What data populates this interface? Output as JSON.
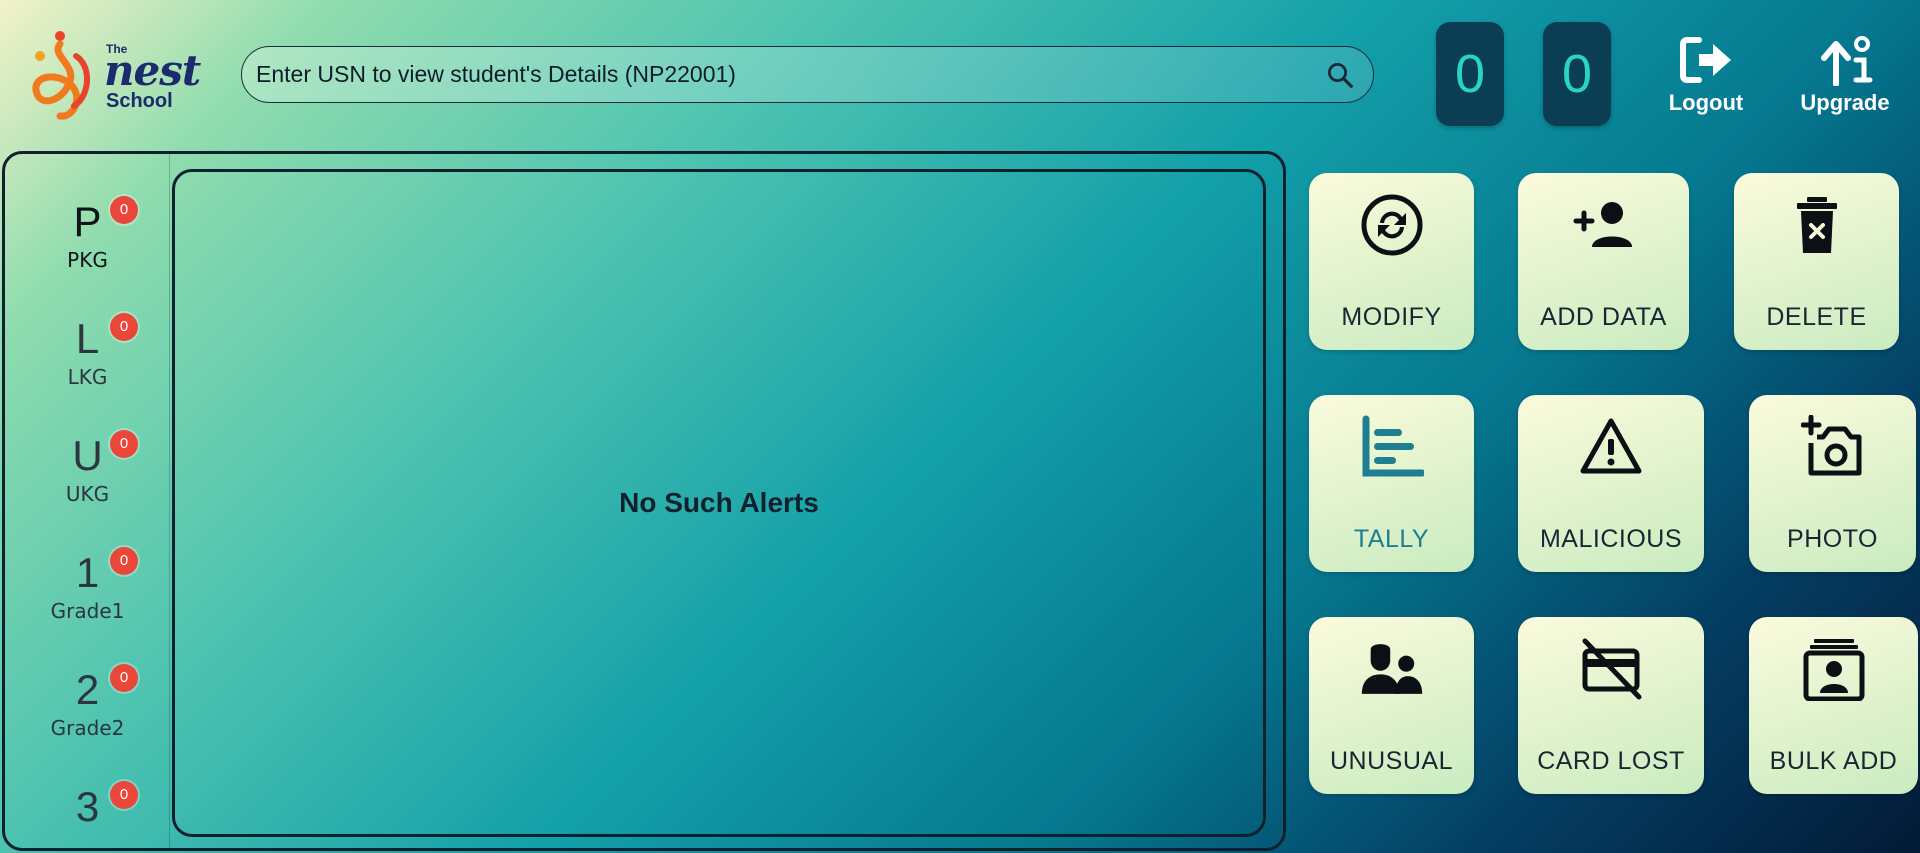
{
  "brand": {
    "line1": "The",
    "line2": "nest",
    "line3": "School"
  },
  "search": {
    "placeholder": "Enter USN to view student's Details (NP22001)"
  },
  "counters": [
    "0",
    "0"
  ],
  "header_buttons": {
    "logout": "Logout",
    "upgrade": "Upgrade"
  },
  "grades": [
    {
      "letter": "P",
      "label": "PKG",
      "badge": "0"
    },
    {
      "letter": "L",
      "label": "LKG",
      "badge": "0"
    },
    {
      "letter": "U",
      "label": "UKG",
      "badge": "0"
    },
    {
      "letter": "1",
      "label": "Grade1",
      "badge": "0"
    },
    {
      "letter": "2",
      "label": "Grade2",
      "badge": "0"
    },
    {
      "letter": "3",
      "label": "",
      "badge": "0"
    }
  ],
  "alerts": {
    "empty_message": "No Such Alerts"
  },
  "actions": [
    {
      "label": "MODIFY",
      "icon": "sync-icon"
    },
    {
      "label": "ADD DATA",
      "icon": "add-person-icon"
    },
    {
      "label": "DELETE",
      "icon": "delete-bin-icon"
    },
    {
      "label": "TALLY",
      "icon": "bar-chart-icon",
      "active": true
    },
    {
      "label": "MALICIOUS",
      "icon": "warning-icon"
    },
    {
      "label": "PHOTO",
      "icon": "add-camera-icon"
    },
    {
      "label": "UNUSUAL",
      "icon": "people-icon"
    },
    {
      "label": "CARD LOST",
      "icon": "card-off-icon"
    },
    {
      "label": "BULK ADD",
      "icon": "contacts-stack-icon"
    }
  ],
  "colors": {
    "badge": "#e8473a",
    "counter_bg": "#0b3d55",
    "counter_digit": "#27d4c6",
    "tile_active_text": "#1e7f90"
  }
}
